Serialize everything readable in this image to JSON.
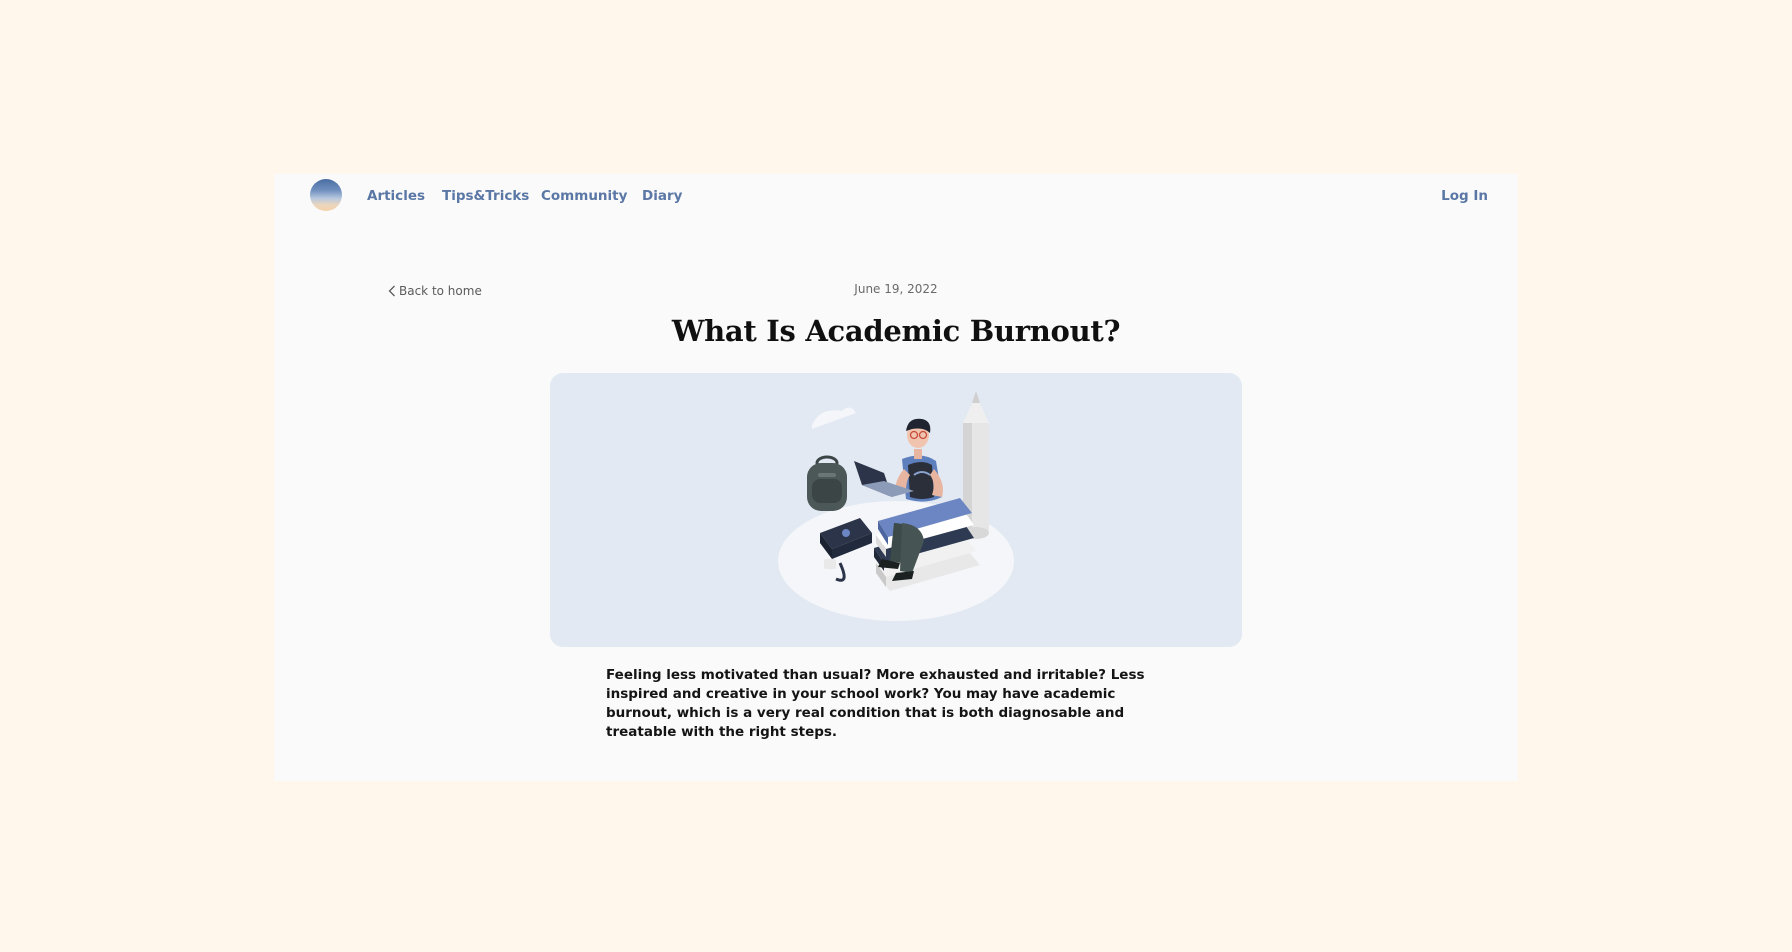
{
  "nav": {
    "items": [
      {
        "label": "Articles"
      },
      {
        "label": "Tips&Tricks"
      },
      {
        "label": "Community"
      },
      {
        "label": "Diary"
      }
    ],
    "login_label": "Log In"
  },
  "article": {
    "back_label": "Back to home",
    "date": "June 19, 2022",
    "title": "What Is Academic Burnout?",
    "intro": "Feeling less motivated than usual? More exhausted and irritable? Less inspired and creative in your school work? You may have academic burnout, which is a very real condition that is both diagnosable and treatable with the right steps."
  },
  "colors": {
    "page_background": "#fff6ec",
    "card_background": "#fafafa",
    "nav_link": "#5a77a5",
    "hero_background": "#e2e9f2"
  },
  "icons": {
    "logo": "gradient-circle-logo",
    "back": "chevron-left-icon"
  }
}
